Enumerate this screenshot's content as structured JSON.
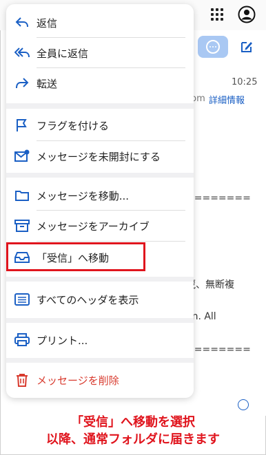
{
  "background": {
    "time": "10:25",
    "addr_fragment": "com",
    "detail_link": "詳細情報",
    "equals_line_1": "========",
    "text_line_1": "蔵、無断複",
    "text_line_2": "on. All",
    "equals_line_2": "========"
  },
  "menu": {
    "reply": "返信",
    "reply_all": "全員に返信",
    "forward": "転送",
    "flag": "フラグを付ける",
    "mark_unread": "メッセージを未開封にする",
    "move": "メッセージを移動...",
    "archive": "メッセージをアーカイブ",
    "move_to_inbox": "「受信」へ移動",
    "show_headers": "すべてのヘッダを表示",
    "print": "プリント...",
    "delete": "メッセージを削除"
  },
  "annotation": {
    "line1": "「受信」へ移動を選択",
    "line2": "以降、通常フォルダに届きます"
  },
  "colors": {
    "accent": "#1a5fc4",
    "danger": "#d83a2e",
    "annotation": "#e0141d"
  }
}
